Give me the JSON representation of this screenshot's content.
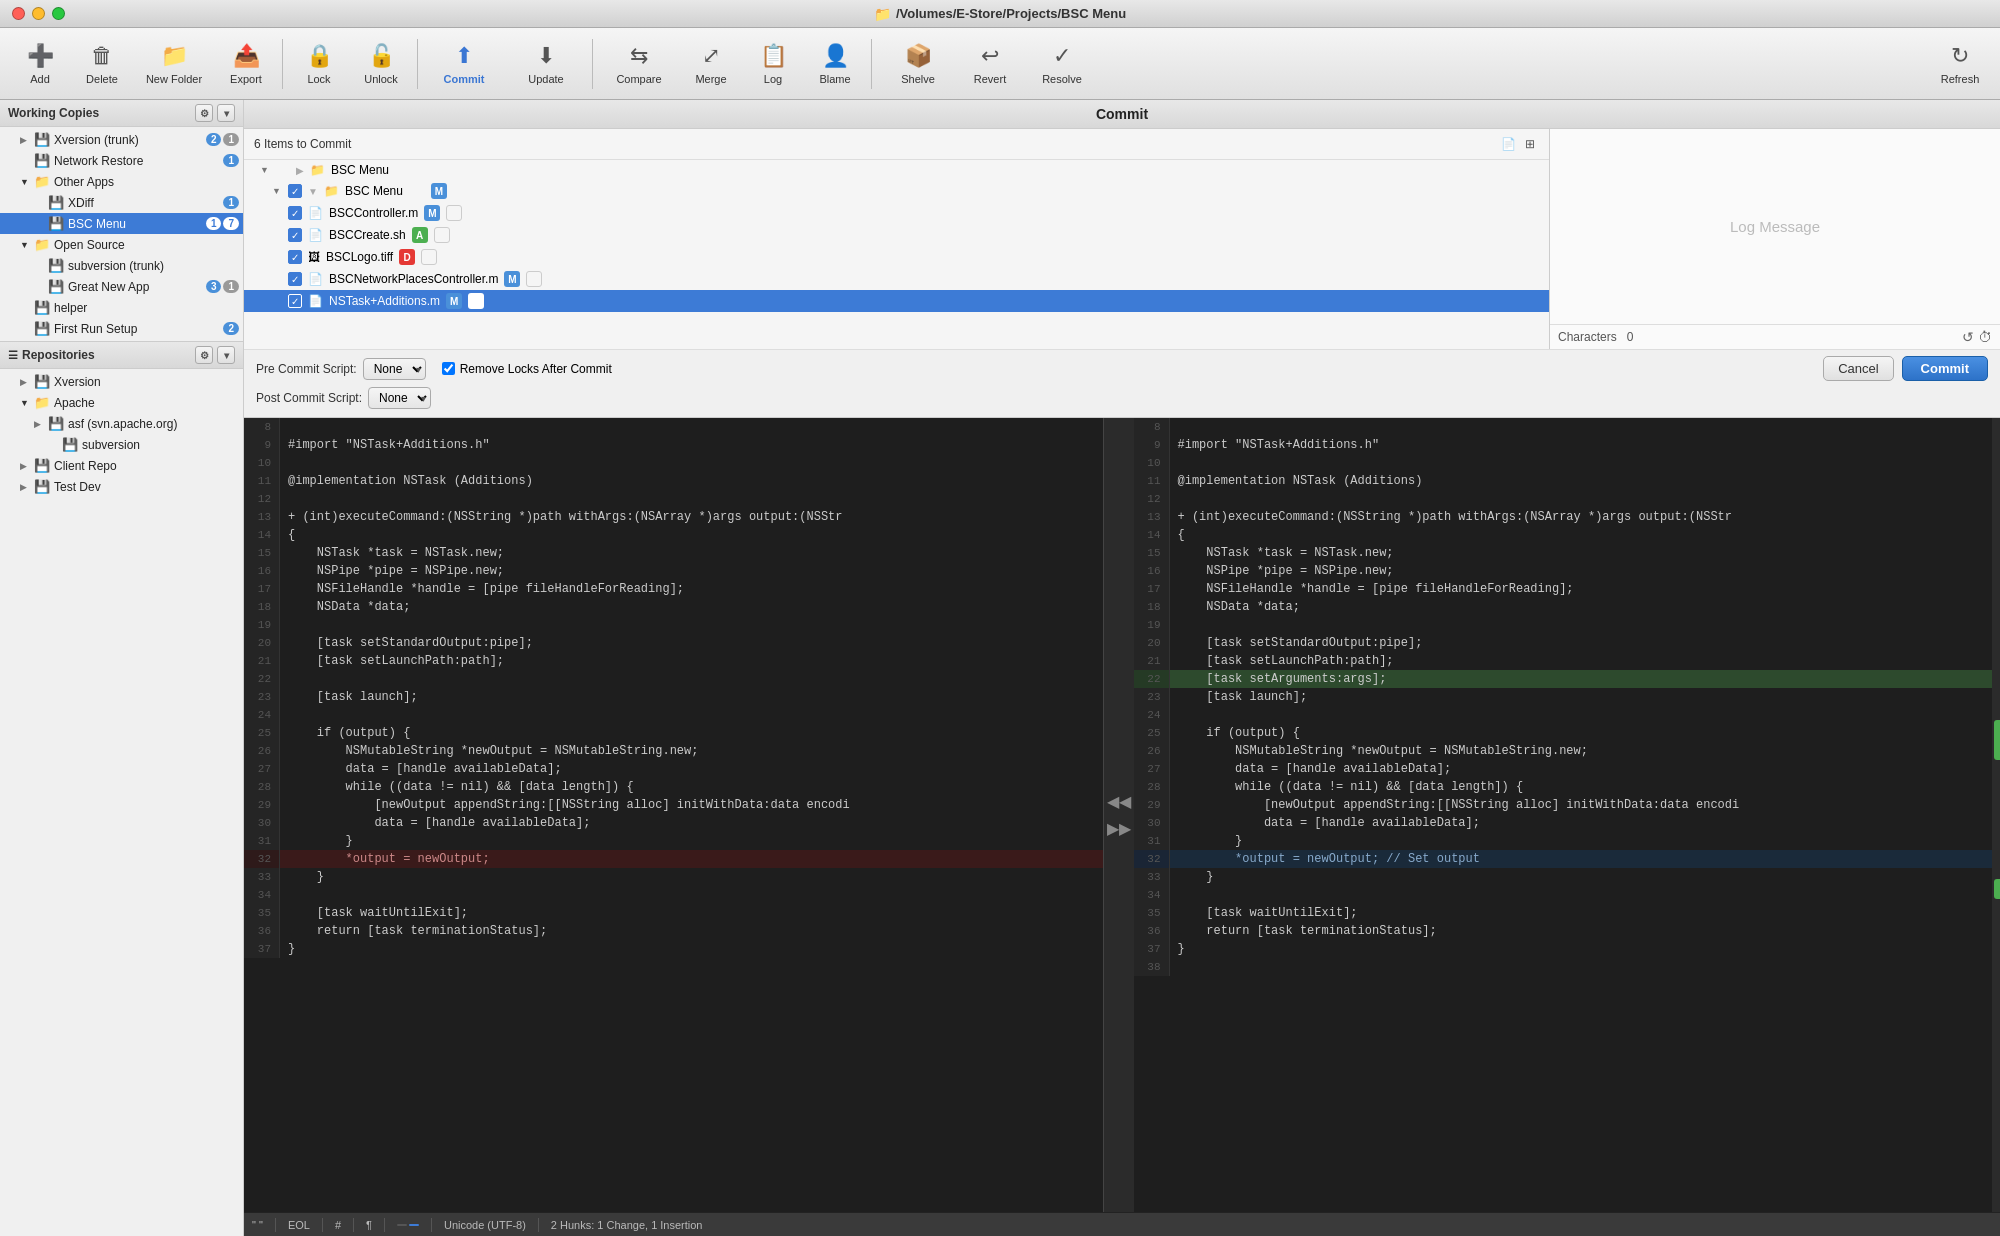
{
  "titlebar": {
    "title": "/Volumes/E-Store/Projects/BSC Menu"
  },
  "toolbar": {
    "add_label": "Add",
    "delete_label": "Delete",
    "new_folder_label": "New Folder",
    "export_label": "Export",
    "lock_label": "Lock",
    "unlock_label": "Unlock",
    "commit_label": "Commit",
    "update_label": "Update",
    "compare_label": "Compare",
    "merge_label": "Merge",
    "log_label": "Log",
    "blame_label": "Blame",
    "shelve_label": "Shelve",
    "revert_label": "Revert",
    "resolve_label": "Resolve",
    "refresh_label": "Refresh"
  },
  "sidebar": {
    "working_copies_label": "Working Copies",
    "repositories_label": "Repositories",
    "items_wc": [
      {
        "label": "Xversion (trunk)",
        "badge1": "2",
        "badge2": "1",
        "indent": 1,
        "type": "disk"
      },
      {
        "label": "Network Restore",
        "badge1": "1",
        "badge2": "",
        "indent": 1,
        "type": "disk"
      },
      {
        "label": "Other Apps",
        "badge1": "",
        "badge2": "",
        "indent": 1,
        "type": "folder",
        "expanded": true
      },
      {
        "label": "XDiff",
        "badge1": "1",
        "badge2": "",
        "indent": 2,
        "type": "disk"
      },
      {
        "label": "BSC Menu",
        "badge1": "1",
        "badge2": "7",
        "indent": 2,
        "type": "disk",
        "selected": true
      },
      {
        "label": "Open Source",
        "badge1": "",
        "badge2": "",
        "indent": 1,
        "type": "folder",
        "expanded": true
      },
      {
        "label": "subversion (trunk)",
        "badge1": "",
        "badge2": "",
        "indent": 2,
        "type": "disk"
      },
      {
        "label": "Great New App",
        "badge1": "3",
        "badge2": "1",
        "indent": 2,
        "type": "disk"
      },
      {
        "label": "helper",
        "badge1": "",
        "badge2": "",
        "indent": 1,
        "type": "disk"
      },
      {
        "label": "First Run Setup",
        "badge1": "2",
        "badge2": "",
        "indent": 1,
        "type": "disk"
      }
    ],
    "items_repos": [
      {
        "label": "Xversion",
        "badge1": "",
        "badge2": "",
        "indent": 1,
        "type": "disk"
      },
      {
        "label": "Apache",
        "badge1": "",
        "badge2": "",
        "indent": 1,
        "type": "folder",
        "expanded": true
      },
      {
        "label": "asf (svn.apache.org)",
        "badge1": "",
        "badge2": "",
        "indent": 2,
        "type": "disk"
      },
      {
        "label": "subversion",
        "badge1": "",
        "badge2": "",
        "indent": 3,
        "type": "disk"
      },
      {
        "label": "Client Repo",
        "badge1": "",
        "badge2": "",
        "indent": 1,
        "type": "disk"
      },
      {
        "label": "Test Dev",
        "badge1": "",
        "badge2": "",
        "indent": 1,
        "type": "disk"
      }
    ]
  },
  "commit_panel": {
    "title": "Commit",
    "items_count_label": "6 Items to Commit",
    "files": [
      {
        "name": "BSC Menu",
        "indent": 1,
        "checked": true,
        "badge": "",
        "is_folder": true,
        "expanded": true
      },
      {
        "name": "BSC Menu",
        "indent": 2,
        "checked": true,
        "badge": "",
        "is_folder": true,
        "expanded": true
      },
      {
        "name": "BSCController.m",
        "indent": 3,
        "checked": true,
        "badge": "M",
        "is_folder": false
      },
      {
        "name": "BSCCreate.sh",
        "indent": 3,
        "checked": true,
        "badge": "A",
        "is_folder": false
      },
      {
        "name": "BSCLogo.tiff",
        "indent": 3,
        "checked": true,
        "badge": "D",
        "is_folder": false
      },
      {
        "name": "BSCNetworkPlacesController.m",
        "indent": 3,
        "checked": true,
        "badge": "M",
        "is_folder": false
      },
      {
        "name": "NSTask+Additions.m",
        "indent": 3,
        "checked": true,
        "badge": "M",
        "is_folder": false,
        "selected": true
      }
    ],
    "log_placeholder": "Log Message",
    "characters_label": "Characters",
    "characters_count": "0",
    "pre_commit_label": "Pre Commit Script:",
    "post_commit_label": "Post Commit Script:",
    "none_option": "None",
    "remove_locks_label": "Remove Locks After Commit",
    "cancel_label": "Cancel",
    "commit_label": "Commit"
  },
  "diff": {
    "left_lines": [
      {
        "num": 8,
        "content": "",
        "type": "normal"
      },
      {
        "num": 9,
        "content": "#import \"NSTask+Additions.h\"",
        "type": "normal"
      },
      {
        "num": 10,
        "content": "",
        "type": "normal"
      },
      {
        "num": 11,
        "content": "@implementation NSTask (Additions)",
        "type": "normal"
      },
      {
        "num": 12,
        "content": "",
        "type": "normal"
      },
      {
        "num": 13,
        "content": "+ (int)executeCommand:(NSString *)path withArgs:(NSArray *)args output:(NSStr",
        "type": "normal"
      },
      {
        "num": 14,
        "content": "{",
        "type": "normal"
      },
      {
        "num": 15,
        "content": "    NSTask *task = NSTask.new;",
        "type": "normal"
      },
      {
        "num": 16,
        "content": "    NSPipe *pipe = NSPipe.new;",
        "type": "normal"
      },
      {
        "num": 17,
        "content": "    NSFileHandle *handle = [pipe fileHandleForReading];",
        "type": "normal"
      },
      {
        "num": 18,
        "content": "    NSData *data;",
        "type": "normal"
      },
      {
        "num": 19,
        "content": "",
        "type": "normal"
      },
      {
        "num": 20,
        "content": "    [task setStandardOutput:pipe];",
        "type": "normal"
      },
      {
        "num": 21,
        "content": "    [task setLaunchPath:path];",
        "type": "normal"
      },
      {
        "num": 22,
        "content": "",
        "type": "normal"
      },
      {
        "num": 23,
        "content": "    [task launch];",
        "type": "normal"
      },
      {
        "num": 24,
        "content": "",
        "type": "normal"
      },
      {
        "num": 25,
        "content": "    if (output) {",
        "type": "normal"
      },
      {
        "num": 26,
        "content": "        NSMutableString *newOutput = NSMutableString.new;",
        "type": "normal"
      },
      {
        "num": 27,
        "content": "        data = [handle availableData];",
        "type": "normal"
      },
      {
        "num": 28,
        "content": "        while ((data != nil) && [data length]) {",
        "type": "normal"
      },
      {
        "num": 29,
        "content": "            [newOutput appendString:[[NSString alloc] initWithData:data encodi",
        "type": "normal"
      },
      {
        "num": 30,
        "content": "            data = [handle availableData];",
        "type": "normal"
      },
      {
        "num": 31,
        "content": "        }",
        "type": "normal"
      },
      {
        "num": 32,
        "content": "        *output = newOutput;",
        "type": "removed"
      },
      {
        "num": 33,
        "content": "    }",
        "type": "normal"
      },
      {
        "num": 34,
        "content": "",
        "type": "normal"
      },
      {
        "num": 35,
        "content": "    [task waitUntilExit];",
        "type": "normal"
      },
      {
        "num": 36,
        "content": "    return [task terminationStatus];",
        "type": "normal"
      },
      {
        "num": 37,
        "content": "}",
        "type": "normal"
      }
    ],
    "right_lines": [
      {
        "num": 8,
        "content": "",
        "type": "normal"
      },
      {
        "num": 9,
        "content": "#import \"NSTask+Additions.h\"",
        "type": "normal"
      },
      {
        "num": 10,
        "content": "",
        "type": "normal"
      },
      {
        "num": 11,
        "content": "@implementation NSTask (Additions)",
        "type": "normal"
      },
      {
        "num": 12,
        "content": "",
        "type": "normal"
      },
      {
        "num": 13,
        "content": "+ (int)executeCommand:(NSString *)path withArgs:(NSArray *)args output:(NSStr",
        "type": "normal"
      },
      {
        "num": 14,
        "content": "{",
        "type": "normal"
      },
      {
        "num": 15,
        "content": "    NSTask *task = NSTask.new;",
        "type": "normal"
      },
      {
        "num": 16,
        "content": "    NSPipe *pipe = NSPipe.new;",
        "type": "normal"
      },
      {
        "num": 17,
        "content": "    NSFileHandle *handle = [pipe fileHandleForReading];",
        "type": "normal"
      },
      {
        "num": 18,
        "content": "    NSData *data;",
        "type": "normal"
      },
      {
        "num": 19,
        "content": "",
        "type": "normal"
      },
      {
        "num": 20,
        "content": "    [task setStandardOutput:pipe];",
        "type": "normal"
      },
      {
        "num": 21,
        "content": "    [task setLaunchPath:path];",
        "type": "normal"
      },
      {
        "num": 22,
        "content": "    [task setArguments:args];",
        "type": "highlighted"
      },
      {
        "num": 23,
        "content": "    [task launch];",
        "type": "normal"
      },
      {
        "num": 24,
        "content": "",
        "type": "normal"
      },
      {
        "num": 25,
        "content": "    if (output) {",
        "type": "normal"
      },
      {
        "num": 26,
        "content": "        NSMutableString *newOutput = NSMutableString.new;",
        "type": "normal"
      },
      {
        "num": 27,
        "content": "        data = [handle availableData];",
        "type": "normal"
      },
      {
        "num": 28,
        "content": "        while ((data != nil) && [data length]) {",
        "type": "normal"
      },
      {
        "num": 29,
        "content": "            [newOutput appendString:[[NSString alloc] initWithData:data encodi",
        "type": "normal"
      },
      {
        "num": 30,
        "content": "            data = [handle availableData];",
        "type": "normal"
      },
      {
        "num": 31,
        "content": "        }",
        "type": "normal"
      },
      {
        "num": 32,
        "content": "        *output = newOutput; // Set output",
        "type": "changed-right"
      },
      {
        "num": 33,
        "content": "    }",
        "type": "normal"
      },
      {
        "num": 34,
        "content": "",
        "type": "normal"
      },
      {
        "num": 35,
        "content": "    [task waitUntilExit];",
        "type": "normal"
      },
      {
        "num": 36,
        "content": "    return [task terminationStatus];",
        "type": "normal"
      },
      {
        "num": 37,
        "content": "}",
        "type": "normal"
      },
      {
        "num": 38,
        "content": "",
        "type": "normal"
      }
    ]
  },
  "status_bar": {
    "cursor": "\" \"",
    "eol": "EOL",
    "hash": "#",
    "pilcrow": "¶",
    "encoding": "Unicode (UTF-8)",
    "hunks": "2 Hunks: 1 Change, 1 Insertion"
  }
}
